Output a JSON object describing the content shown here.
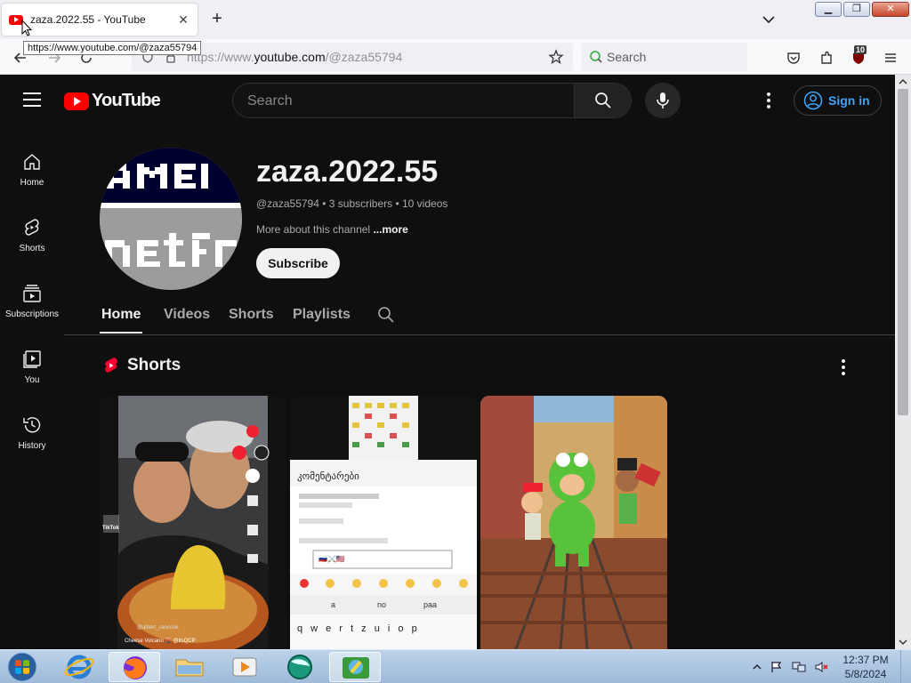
{
  "browser": {
    "tab_title": "zaza.2022.55 - YouTube",
    "tooltip": "https://www.youtube.com/@zaza55794",
    "url_prefix": "https://www.",
    "url_host": "youtube.com",
    "url_path": "/@zaza55794",
    "search_placeholder": "Search",
    "extension_badge": "10"
  },
  "youtube": {
    "search_placeholder": "Search",
    "sign_in_label": "Sign in",
    "guide": [
      {
        "label": "Home",
        "icon": "home-icon"
      },
      {
        "label": "Shorts",
        "icon": "shorts-icon"
      },
      {
        "label": "Subscriptions",
        "icon": "subscriptions-icon"
      },
      {
        "label": "You",
        "icon": "you-icon"
      },
      {
        "label": "History",
        "icon": "history-icon"
      }
    ],
    "channel": {
      "name": "zaza.2022.55",
      "meta": "@zaza55794 • 3 subscribers • 10 videos",
      "about": "More about this channel",
      "more": "...more",
      "subscribe_label": "Subscribe"
    },
    "tabs": [
      {
        "label": "Home",
        "active": true
      },
      {
        "label": "Videos",
        "active": false
      },
      {
        "label": "Shorts",
        "active": false
      },
      {
        "label": "Playlists",
        "active": false
      }
    ],
    "shorts_section_title": "Shorts",
    "short_thumbs": [
      {
        "caption": "Cheese Volcano 🌋 @itsQCP",
        "user": "@albert_cancook",
        "tiktok": "TikTok"
      },
      {
        "header": "კომენტარები",
        "keyboard_suggestions": [
          "a",
          "no",
          "paa"
        ],
        "keyboard_row": "q w e r t z u i o p",
        "input_value": "🇷🇺⚔️🇺🇸"
      },
      {}
    ]
  },
  "taskbar": {
    "time": "12:37 PM",
    "date": "5/8/2024"
  },
  "colors": {
    "yt_red": "#ff0000",
    "yt_background": "#0f0f0f",
    "link_blue": "#3ea6ff"
  }
}
